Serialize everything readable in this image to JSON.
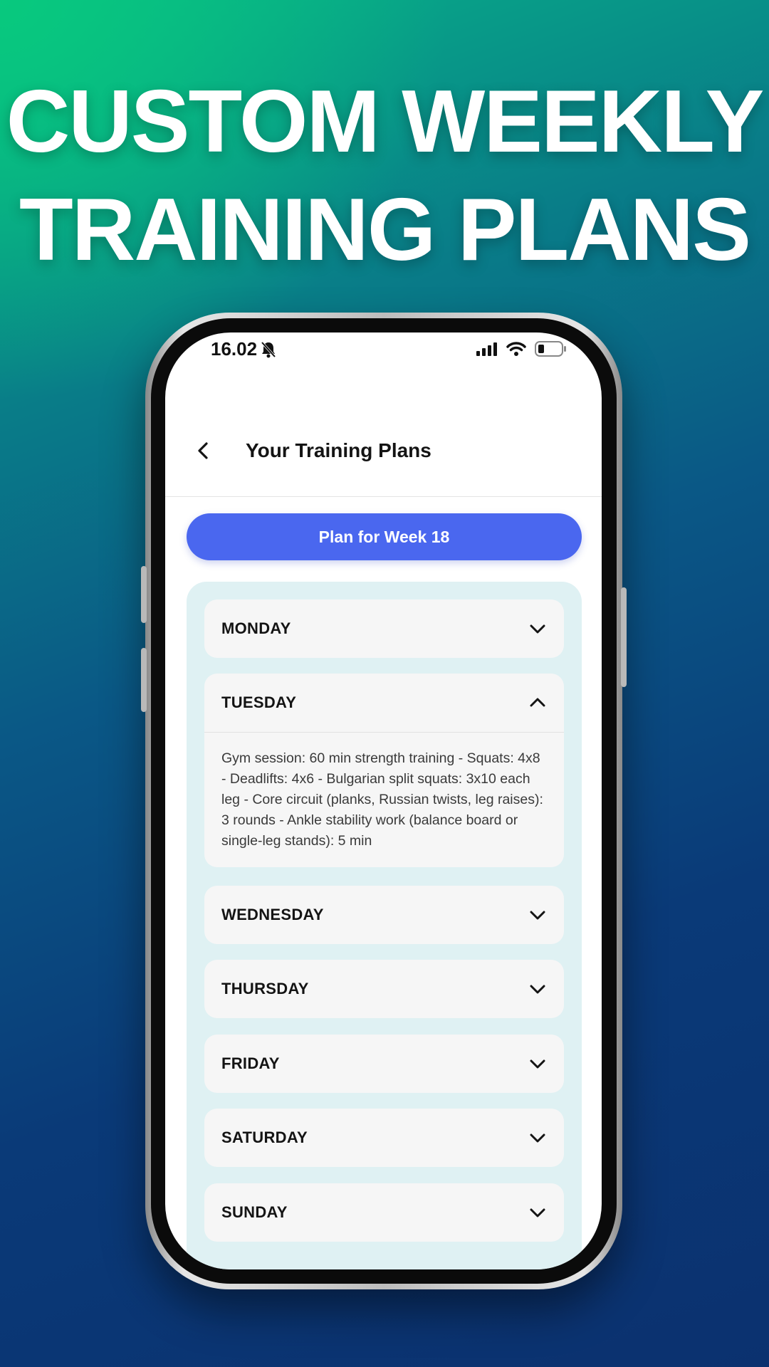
{
  "headline": {
    "line1": "CUSTOM WEEKLY",
    "line2": "TRAINING PLANS"
  },
  "status_bar": {
    "time": "16.02",
    "icons": [
      "bell-off-icon",
      "signal-icon",
      "wifi-icon",
      "battery-icon"
    ]
  },
  "nav": {
    "back_icon": "chevron-left-icon",
    "title": "Your Training Plans"
  },
  "plan_button": {
    "label": "Plan for Week 18"
  },
  "days": [
    {
      "label": "MONDAY",
      "expanded": false
    },
    {
      "label": "TUESDAY",
      "expanded": true,
      "content": "Gym session: 60 min strength training - Squats: 4x8 - Deadlifts: 4x6 - Bulgarian split squats: 3x10 each leg - Core circuit (planks, Russian twists, leg raises): 3 rounds - Ankle stability work (balance board or single-leg stands): 5 min"
    },
    {
      "label": "WEDNESDAY",
      "expanded": false
    },
    {
      "label": "THURSDAY",
      "expanded": false
    },
    {
      "label": "FRIDAY",
      "expanded": false
    },
    {
      "label": "SATURDAY",
      "expanded": false
    },
    {
      "label": "SUNDAY",
      "expanded": false
    }
  ],
  "colors": {
    "accent": "#4a67ef",
    "panel": "#dff1f3",
    "card": "#f6f6f6"
  }
}
